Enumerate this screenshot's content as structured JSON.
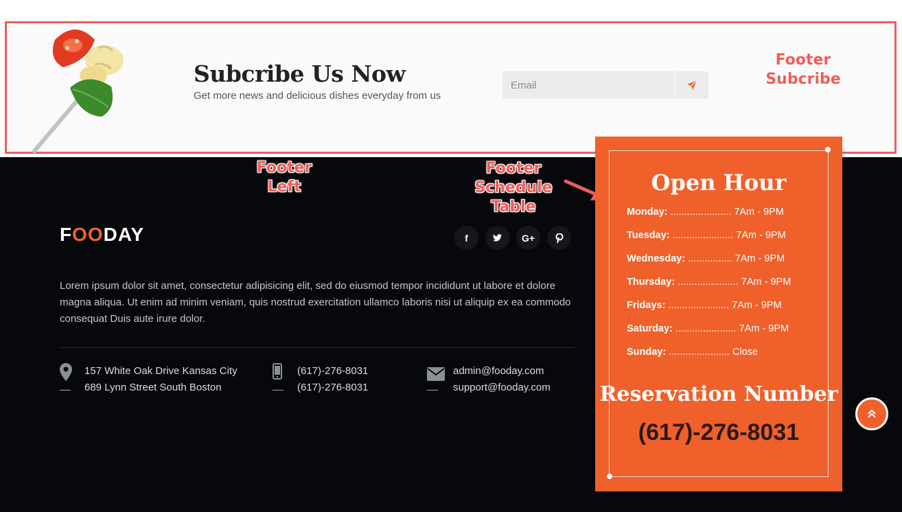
{
  "subscribe": {
    "title": "Subcribe Us Now",
    "subtitle": "Get more news and delicious dishes everyday from us",
    "email_placeholder": "Email",
    "send_icon": "paper-plane-icon"
  },
  "annotations": {
    "subscribe": "Footer\nSubcribe",
    "left": "Footer\nLeft",
    "schedule": "Footer\nSchedule\nTable"
  },
  "footer": {
    "logo_pre": "F",
    "logo_o1": "O",
    "logo_o2": "O",
    "logo_post": "DAY",
    "social_icons": [
      "facebook-icon",
      "twitter-icon",
      "google-plus-icon",
      "pinterest-icon"
    ],
    "social_labels": [
      "f",
      "",
      "G+",
      ""
    ],
    "about": "Lorem ipsum dolor sit amet, consectetur adipisicing elit, sed do eiusmod tempor incididunt ut labore et dolore magna aliqua. Ut enim ad minim veniam, quis nostrud exercitation ullamco laboris nisi ut aliquip ex ea commodo consequat Duis aute irure dolor.",
    "address": [
      "157 White Oak Drive Kansas City",
      "689 Lynn Street South Boston"
    ],
    "phones": [
      "(617)-276-8031",
      "(617)-276-8031"
    ],
    "emails": [
      "admin@fooday.com",
      "support@fooday.com"
    ]
  },
  "schedule": {
    "title": "Open Hour",
    "rows": [
      {
        "day": "Monday:",
        "dots": "......................",
        "time": "7Am - 9PM"
      },
      {
        "day": "Tuesday:",
        "dots": "......................",
        "time": "7Am - 9PM"
      },
      {
        "day": "Wednesday:",
        "dots": "................",
        "time": "7Am - 9PM"
      },
      {
        "day": "Thursday:",
        "dots": "......................",
        "time": "7Am - 9PM"
      },
      {
        "day": "Fridays:",
        "dots": "......................",
        "time": "7Am - 9PM"
      },
      {
        "day": "Saturday:",
        "dots": "......................",
        "time": "7Am - 9PM"
      },
      {
        "day": "Sunday:",
        "dots": "......................",
        "time": "Close"
      }
    ],
    "reservation_title": "Reservation Number",
    "reservation_number": "(617)-276-8031"
  },
  "colors": {
    "accent": "#f0602a",
    "annotation": "#ef5d5a",
    "footer_bg": "#07080c"
  }
}
